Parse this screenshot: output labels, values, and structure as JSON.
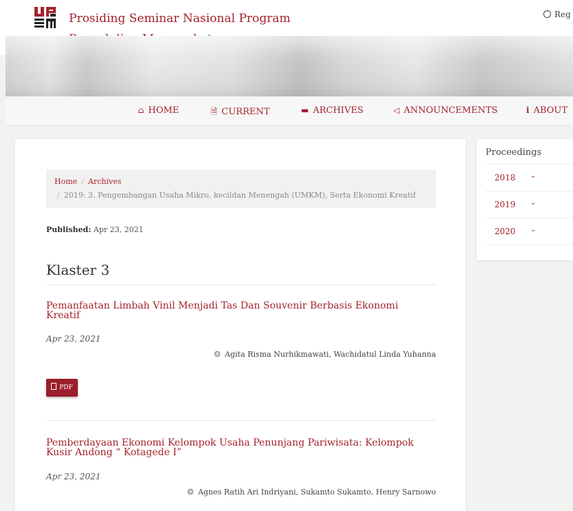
{
  "header": {
    "site_title_line1": "Prosiding Seminar Nasional Program",
    "site_title_line2": "Pengabdian Masyarakat",
    "register_label": "Reg"
  },
  "nav": {
    "items": [
      {
        "icon": "home-icon",
        "label": "HOME"
      },
      {
        "icon": "document-icon",
        "label": "CURRENT"
      },
      {
        "icon": "archive-icon",
        "label": "ARCHIVES"
      },
      {
        "icon": "bullhorn-icon",
        "label": "ANNOUNCEMENTS"
      },
      {
        "icon": "info-icon",
        "label": "ABOUT"
      }
    ]
  },
  "breadcrumb": {
    "home": "Home",
    "separator": "/",
    "archives": "Archives",
    "current": "2019: 3. Pengembangan Usaha Mikro, kecildan Menengah (UMKM), Serta Ekonomi Kreatif"
  },
  "published": {
    "label": "Published:",
    "date": "Apr 23, 2021"
  },
  "section_title": "Klaster 3",
  "articles": [
    {
      "title": "Pemanfaatan Limbah Vinil Menjadi Tas Dan Souvenir Berbasis Ekonomi Kreatif",
      "date": "Apr 23, 2021",
      "authors": "Agita Risma Nurhikmawati, Wachidatul Linda Yuhanna",
      "galley_label": "PDF"
    },
    {
      "title": "Pemberdayaan Ekonomi Kelompok Usaha Penunjang Pariwisata: Kelompok Kusir Andong “ Kotagede I”",
      "date": "Apr 23, 2021",
      "authors": "Agnes Ratih Ari Indriyani, Sukamto Sukamto, Henry Sarnowo"
    }
  ],
  "sidebar": {
    "title": "Proceedings",
    "years": [
      "2018",
      "2019",
      "2020"
    ]
  },
  "colors": {
    "accent": "#a3232b",
    "button": "#9b1f2b"
  }
}
